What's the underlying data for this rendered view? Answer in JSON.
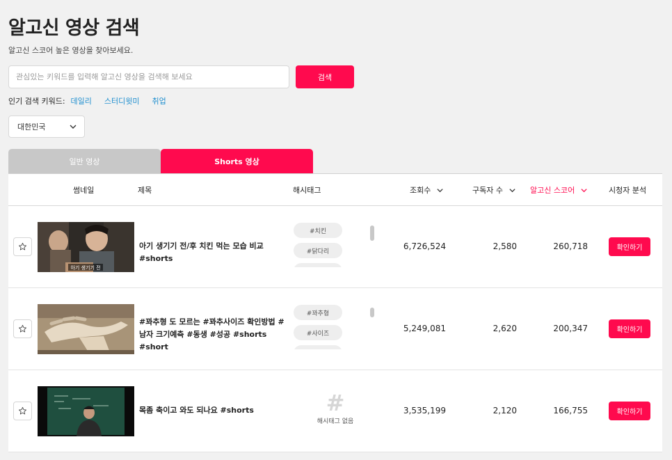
{
  "page": {
    "title": "알고신 영상 검색",
    "subtitle": "알고신 스코어 높은 영상을 찾아보세요."
  },
  "search": {
    "placeholder": "관심있는 키워드를 입력해 알고신 영상을 검색해 보세요",
    "value": "",
    "button_label": "검색"
  },
  "popular": {
    "label": "인기 검색 키워드:",
    "keywords": [
      "데일리",
      "스터디윗미",
      "취업"
    ]
  },
  "country": {
    "selected": "대한민국",
    "icon": "chevron-down-icon"
  },
  "tabs": [
    {
      "label": "일반 영상",
      "active": false
    },
    {
      "label": "Shorts 영상",
      "active": true
    }
  ],
  "table": {
    "headers": {
      "thumbnail": "썸네일",
      "title": "제목",
      "hashtags": "해시태그",
      "views": "조회수",
      "subscribers": "구독자 수",
      "score": "알고신 스코어",
      "analysis": "시청자 분석"
    },
    "no_tag_symbol": "#",
    "no_tag_text": "해시태그 없음",
    "action_label": "확인하기",
    "rows": [
      {
        "title": "아기 생기기 전/후 치킨 먹는 모습 비교 #shorts",
        "tags": [
          "#치킨",
          "#닭다리"
        ],
        "views": "6,726,524",
        "subscribers": "2,580",
        "score": "260,718",
        "thumb_caption": "아기 생기기 전"
      },
      {
        "title": "#꽈추형 도 모르는 #꽈추사이즈 확인방법 #남자 크기예측 #동생 #성공 #shorts #short",
        "tags": [
          "#꽈추형",
          "#사이즈"
        ],
        "views": "5,249,081",
        "subscribers": "2,620",
        "score": "200,347"
      },
      {
        "title": "목좀 축이고 와도 되나요 #shorts",
        "tags": [],
        "views": "3,535,199",
        "subscribers": "2,120",
        "score": "166,755"
      }
    ]
  },
  "colors": {
    "accent": "#ff0a4e",
    "link": "#1f8fcf",
    "tab_inactive": "#c8c8c8"
  }
}
